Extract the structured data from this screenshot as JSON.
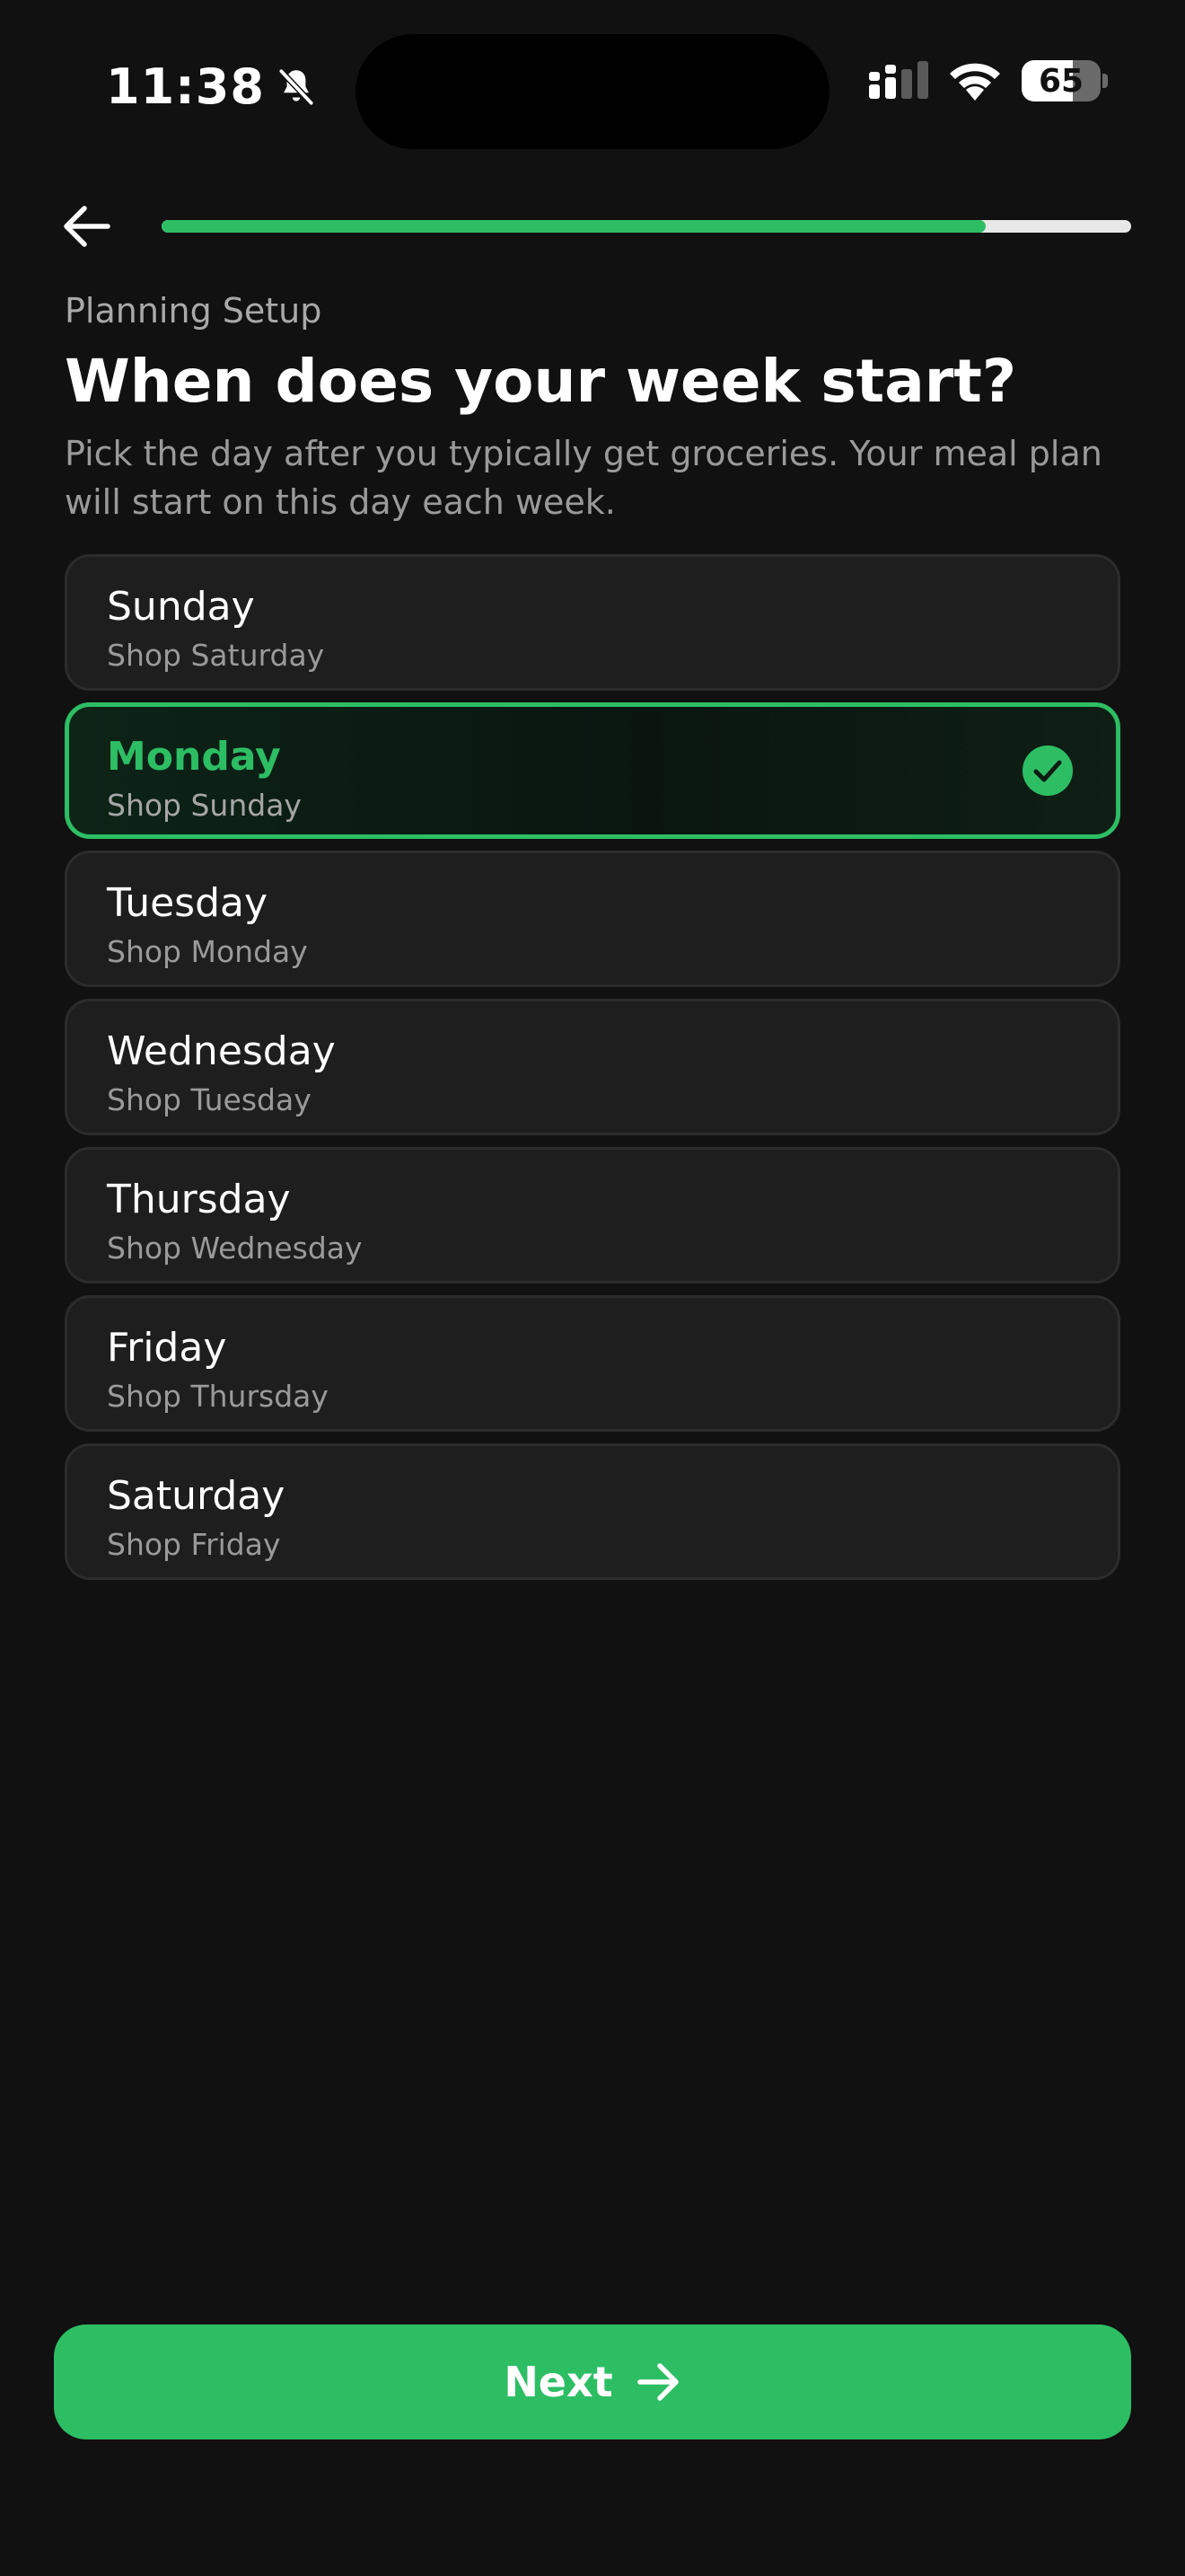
{
  "status_bar": {
    "time": "11:38",
    "battery_level": "65",
    "battery_fraction": 0.65,
    "icons": [
      "bell-slash-icon",
      "cellular-signal-icon",
      "wifi-icon",
      "battery-icon"
    ]
  },
  "header": {
    "back_icon": "arrow-left-icon",
    "progress_fraction": 0.85,
    "progress_color": "#2dbe64"
  },
  "intro": {
    "eyebrow": "Planning Setup",
    "title": "When does your week start?",
    "subtitle": "Pick the day after you typically get groceries. Your meal plan will start on this day each week."
  },
  "options": [
    {
      "label": "Sunday",
      "sublabel": "Shop Saturday",
      "selected": false
    },
    {
      "label": "Monday",
      "sublabel": "Shop Sunday",
      "selected": true
    },
    {
      "label": "Tuesday",
      "sublabel": "Shop Monday",
      "selected": false
    },
    {
      "label": "Wednesday",
      "sublabel": "Shop Tuesday",
      "selected": false
    },
    {
      "label": "Thursday",
      "sublabel": "Shop Wednesday",
      "selected": false
    },
    {
      "label": "Friday",
      "sublabel": "Shop Thursday",
      "selected": false
    },
    {
      "label": "Saturday",
      "sublabel": "Shop Friday",
      "selected": false
    }
  ],
  "selected_check_icon": "check-circle-icon",
  "footer": {
    "next_label": "Next",
    "next_icon": "arrow-right-icon"
  },
  "colors": {
    "background": "#111111",
    "accent": "#2dbe64",
    "card": "#1e1e1e"
  }
}
